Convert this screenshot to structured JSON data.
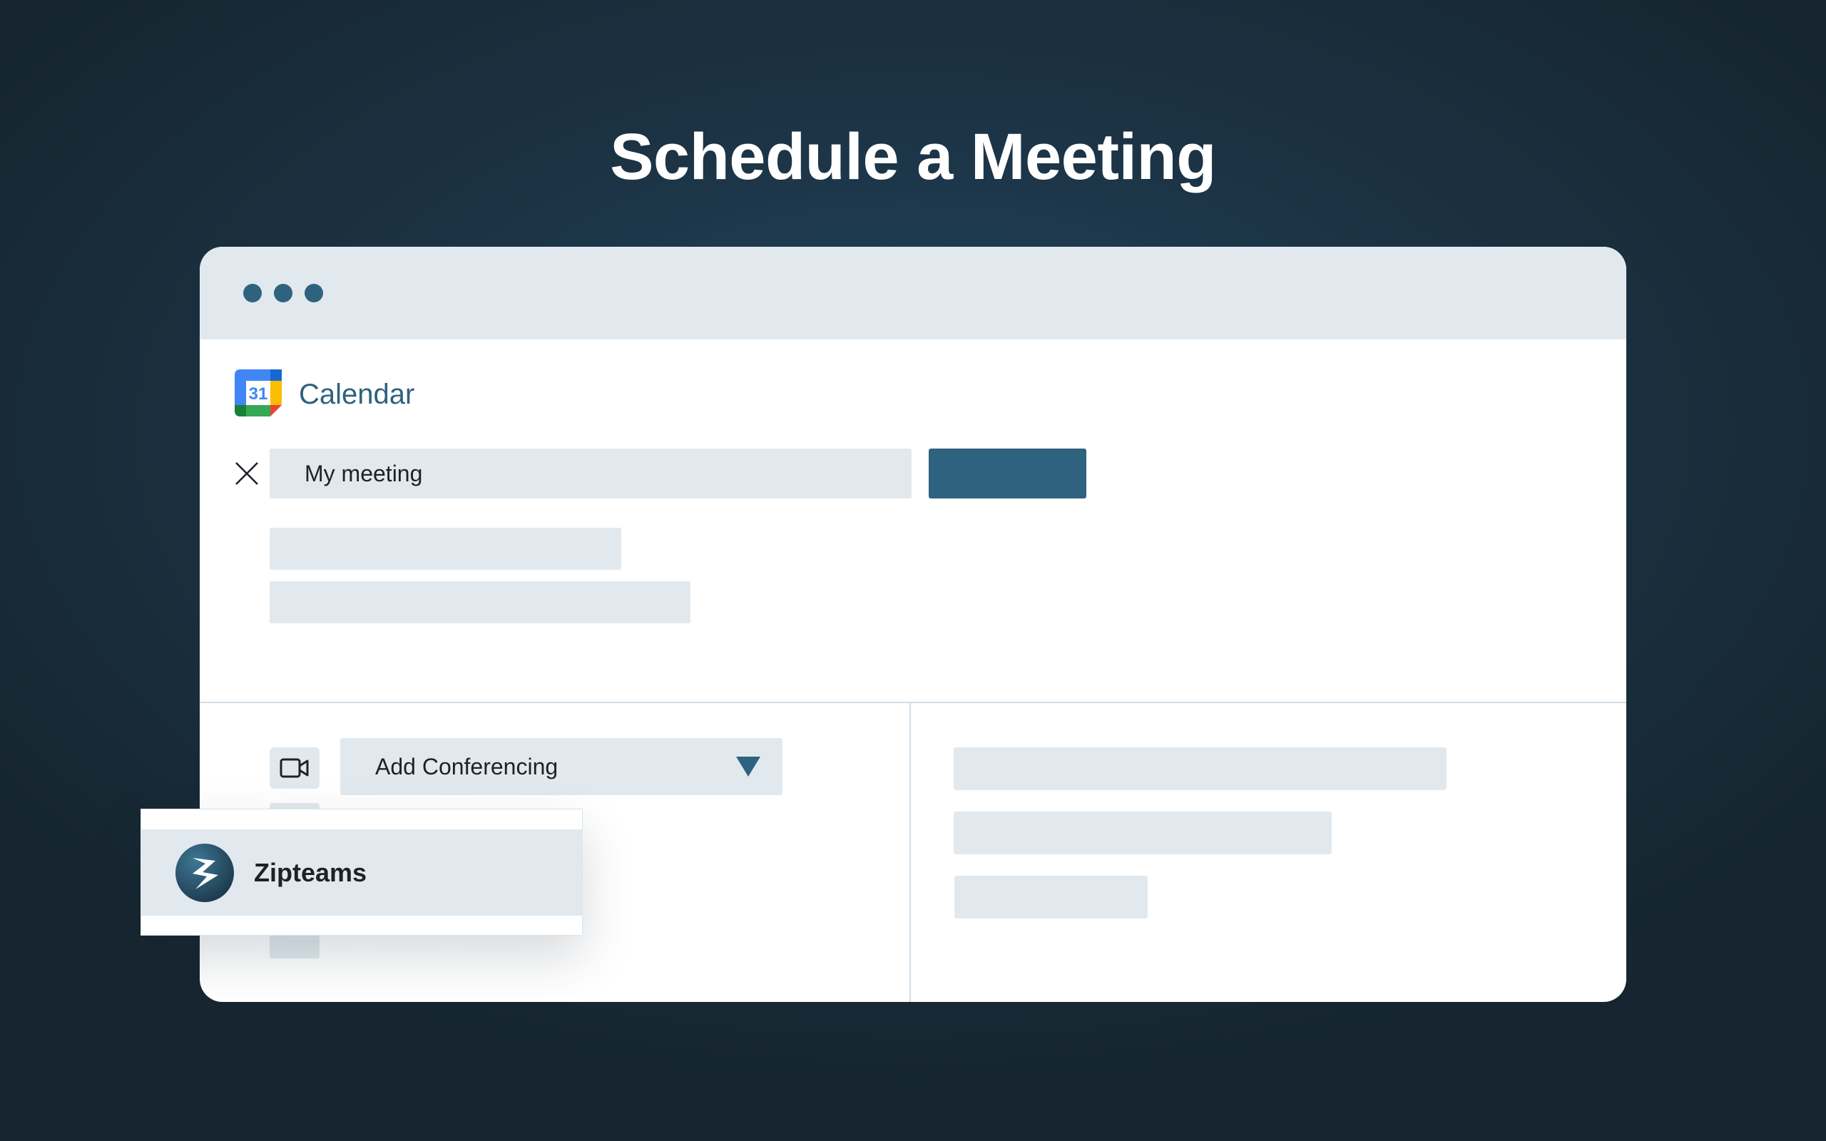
{
  "headline": "Schedule a Meeting",
  "app": {
    "title": "Calendar",
    "logo_text": "31"
  },
  "event": {
    "title_value": "My meeting"
  },
  "conferencing": {
    "select_label": "Add Conferencing",
    "options": [
      {
        "label": "Zipteams",
        "icon": "zipteams-logo"
      }
    ]
  },
  "icons": {
    "close": "close-icon",
    "video": "video-camera-icon",
    "dropdown": "chevron-down-icon"
  },
  "colors": {
    "background": "#1c3446",
    "accent": "#2f627e",
    "placeholder": "#e2e9ee",
    "window": "#ffffff"
  }
}
